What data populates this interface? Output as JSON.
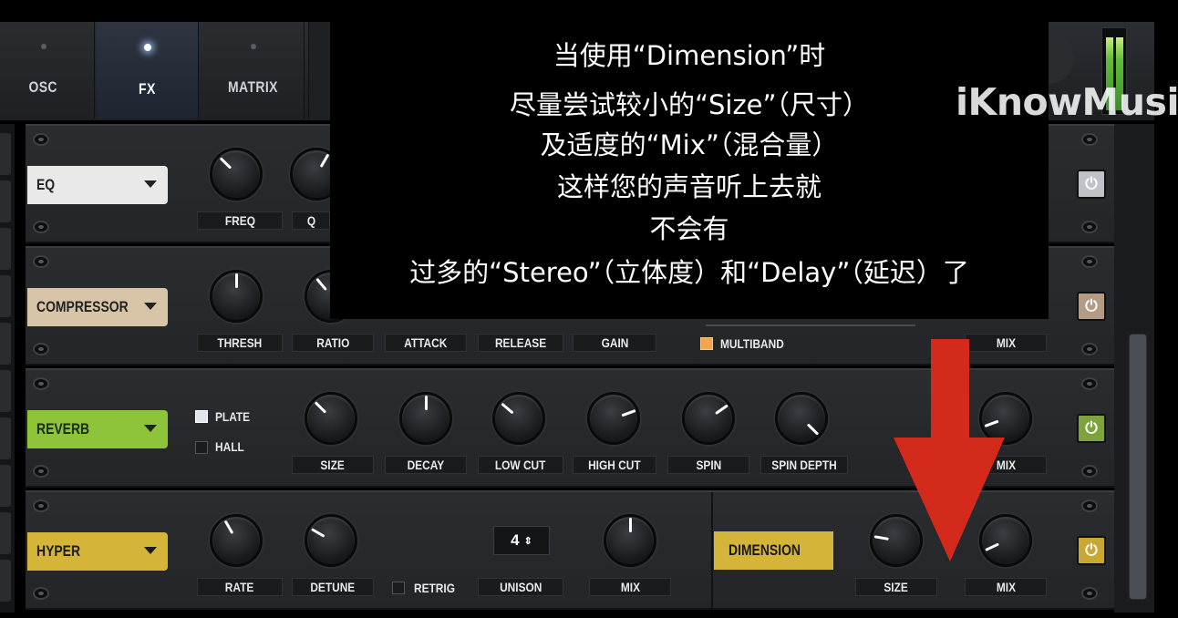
{
  "tabs": [
    {
      "label": "OSC",
      "active": false
    },
    {
      "label": "FX",
      "active": true
    },
    {
      "label": "MATRIX",
      "active": false
    }
  ],
  "subtitle": {
    "lines": [
      "当使用“Dimension”时",
      "尽量尝试较小的“Size”（尺寸）",
      "及适度的“Mix”（混合量）",
      "这样您的声音听上去就",
      "不会有",
      "过多的“Stereo”（立体度）和“Delay”（延迟）了"
    ]
  },
  "watermark": "iKnowMusic",
  "rows": {
    "eq": {
      "label": "EQ",
      "color": "#e9e9e9",
      "params": [
        "FREQ",
        "Q"
      ]
    },
    "compressor": {
      "label": "COMPRESSOR",
      "color": "#d8c4a6",
      "params": [
        "THRESH",
        "RATIO",
        "ATTACK",
        "RELEASE",
        "GAIN"
      ],
      "multiband_label": "MULTIBAND",
      "multiband_checked": true,
      "mix_label": "MIX"
    },
    "reverb": {
      "label": "REVERB",
      "color": "#8ec43a",
      "modes": [
        {
          "label": "PLATE",
          "checked": true
        },
        {
          "label": "HALL",
          "checked": false
        }
      ],
      "params": [
        "SIZE",
        "DECAY",
        "LOW CUT",
        "HIGH CUT",
        "SPIN",
        "SPIN DEPTH"
      ],
      "mix_label": "MIX"
    },
    "hyper": {
      "label": "HYPER",
      "color": "#d4b53a",
      "params": [
        "RATE",
        "DETUNE"
      ],
      "retrig_label": "RETRIG",
      "retrig_checked": false,
      "unison_label": "UNISON",
      "unison_value": "4",
      "mix_label": "MIX",
      "dimension_label": "DIMENSION",
      "dimension_params": [
        "SIZE",
        "MIX"
      ]
    }
  },
  "annotation_arrow_color": "#d42a1c"
}
